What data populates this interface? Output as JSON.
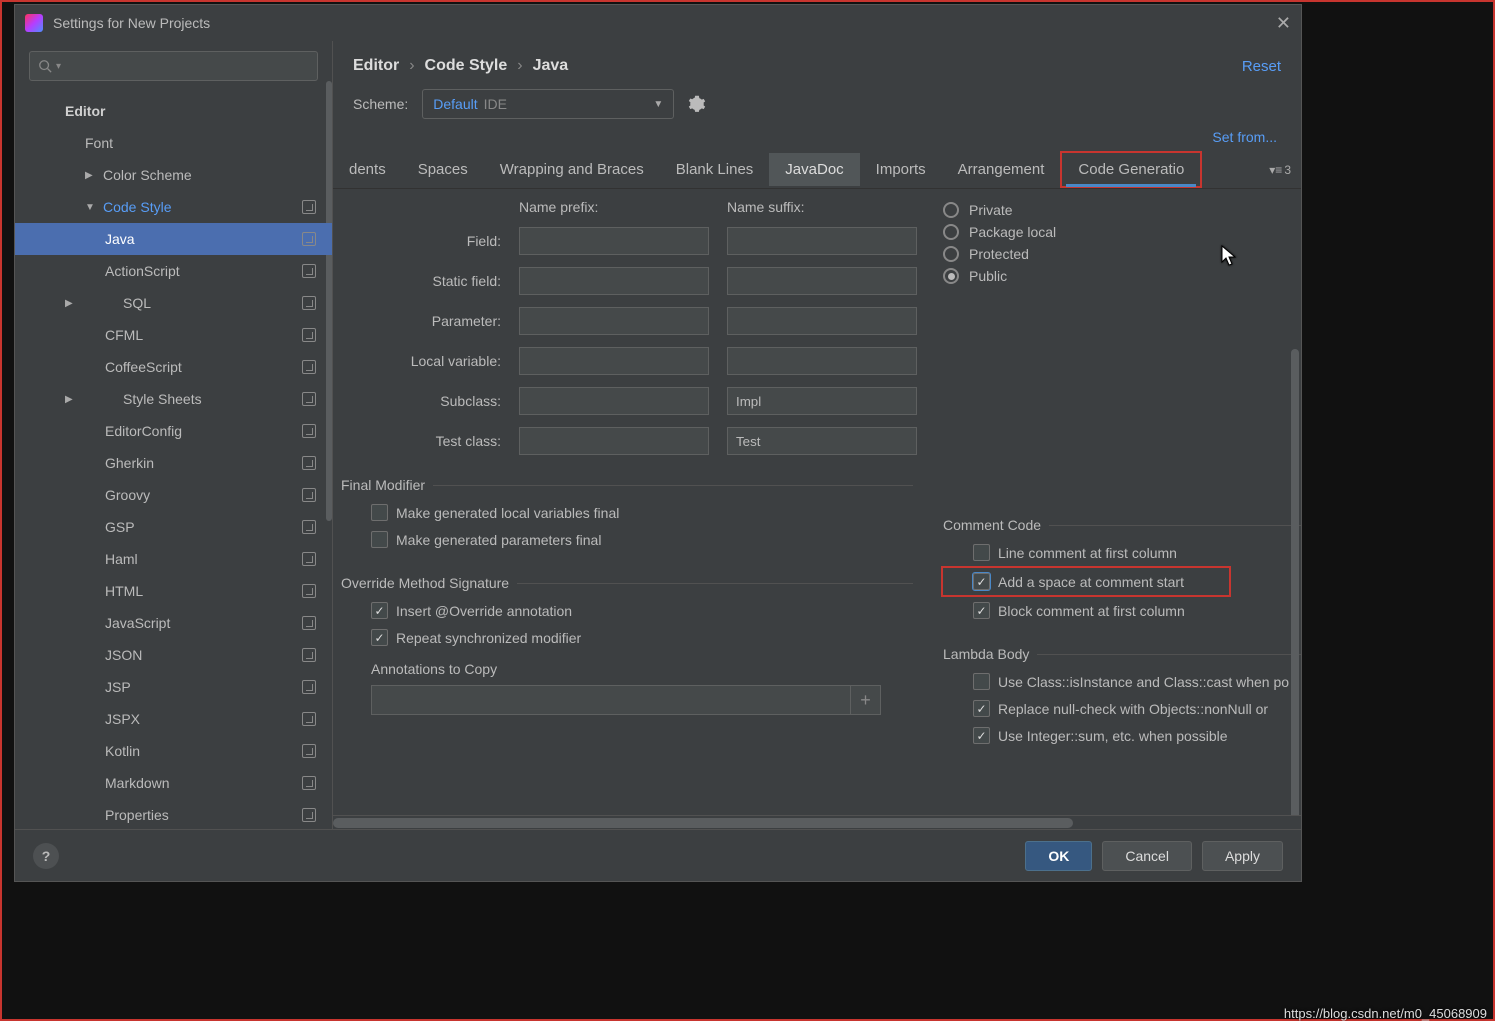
{
  "window": {
    "title": "Settings for New Projects"
  },
  "sidebar": {
    "search_placeholder": "",
    "top": "Editor",
    "font": "Font",
    "color_scheme": "Color Scheme",
    "code_style": "Code Style",
    "items": [
      "Java",
      "ActionScript",
      "SQL",
      "CFML",
      "CoffeeScript",
      "Style Sheets",
      "EditorConfig",
      "Gherkin",
      "Groovy",
      "GSP",
      "Haml",
      "HTML",
      "JavaScript",
      "JSON",
      "JSP",
      "JSPX",
      "Kotlin",
      "Markdown",
      "Properties"
    ]
  },
  "breadcrumb": {
    "a": "Editor",
    "b": "Code Style",
    "c": "Java",
    "reset": "Reset"
  },
  "scheme": {
    "label": "Scheme:",
    "name": "Default",
    "scope": "IDE"
  },
  "setfrom": "Set from...",
  "tabs": {
    "list": [
      "dents",
      "Spaces",
      "Wrapping and Braces",
      "Blank Lines",
      "JavaDoc",
      "Imports",
      "Arrangement",
      "Code Generatio"
    ],
    "active": "JavaDoc",
    "highlighted": "Code Generatio",
    "overflow_count": "3"
  },
  "naming": {
    "prefix_hdr": "Name prefix:",
    "suffix_hdr": "Name suffix:",
    "rows": [
      {
        "label": "Field:",
        "pfx": "",
        "sfx": ""
      },
      {
        "label": "Static field:",
        "pfx": "",
        "sfx": ""
      },
      {
        "label": "Parameter:",
        "pfx": "",
        "sfx": ""
      },
      {
        "label": "Local variable:",
        "pfx": "",
        "sfx": ""
      },
      {
        "label": "Subclass:",
        "pfx": "",
        "sfx": "Impl"
      },
      {
        "label": "Test class:",
        "pfx": "",
        "sfx": "Test"
      }
    ]
  },
  "visibility": {
    "options": [
      "Private",
      "Package local",
      "Protected",
      "Public"
    ],
    "selected": "Public"
  },
  "final_mod": {
    "legend": "Final Modifier",
    "a": "Make generated local variables final",
    "b": "Make generated parameters final"
  },
  "comment": {
    "legend": "Comment Code",
    "a": "Line comment at first column",
    "b": "Add a space at comment start",
    "c": "Block comment at first column"
  },
  "override": {
    "legend": "Override Method Signature",
    "a": "Insert @Override annotation",
    "b": "Repeat synchronized modifier",
    "ann": "Annotations to Copy"
  },
  "lambda": {
    "legend": "Lambda Body",
    "a": "Use Class::isInstance and Class::cast when po",
    "b": "Replace null-check with Objects::nonNull or",
    "c": "Use Integer::sum, etc. when possible"
  },
  "footer": {
    "ok": "OK",
    "cancel": "Cancel",
    "apply": "Apply"
  },
  "watermark": "https://blog.csdn.net/m0_45068909"
}
